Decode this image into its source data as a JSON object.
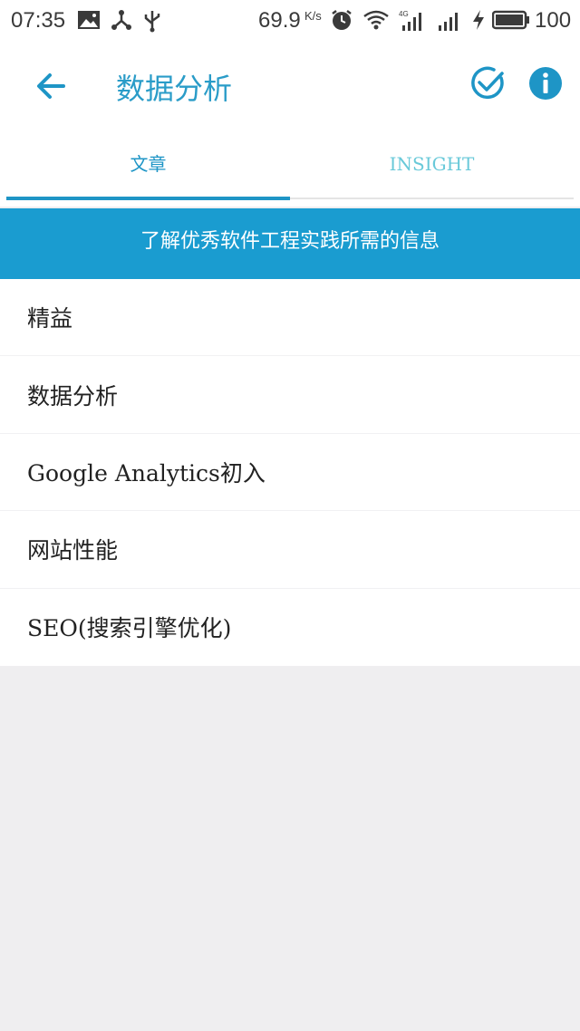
{
  "status_bar": {
    "time": "07:35",
    "net_speed": "69.9",
    "net_speed_unit": "K/s",
    "battery": "100",
    "icons": [
      "image-icon",
      "share-icon",
      "usb-icon",
      "alarm-icon",
      "wifi-icon",
      "signal-4g-icon",
      "signal-icon",
      "charging-icon",
      "battery-icon"
    ]
  },
  "app_bar": {
    "title": "数据分析",
    "icons": [
      "back-arrow-icon",
      "check-circle-icon",
      "info-icon"
    ],
    "accent_color": "#2a9cc8"
  },
  "tabs": [
    {
      "label": "文章",
      "selected": true
    },
    {
      "label": "INSIGHT",
      "selected": false
    }
  ],
  "banner": {
    "text": "了解优秀软件工程实践所需的信息",
    "color": "#1a9cd0"
  },
  "list": {
    "items": [
      {
        "label": "精益"
      },
      {
        "label": "数据分析"
      },
      {
        "label": "Google Analytics初入"
      },
      {
        "label": "网站性能"
      },
      {
        "label": "SEO(搜索引擎优化)"
      }
    ]
  }
}
